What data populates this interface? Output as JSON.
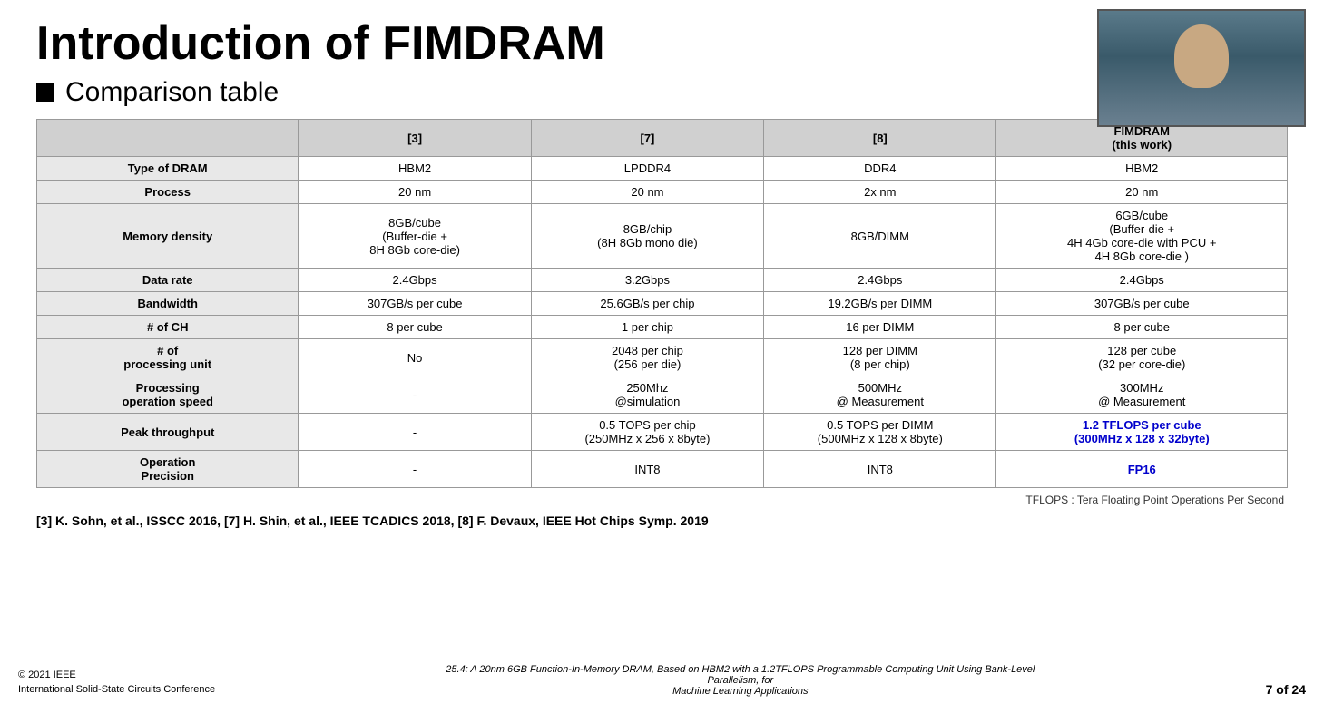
{
  "title": "Introduction of FIMDRAM",
  "subtitle": "Comparison table",
  "webcam_alt": "presenter webcam",
  "table": {
    "headers": [
      "",
      "[3]",
      "[7]",
      "[8]",
      "FIMDRAM\n(this work)"
    ],
    "rows": [
      {
        "label": "Type of DRAM",
        "col3": "HBM2",
        "col7": "LPDDR4",
        "col8": "DDR4",
        "fimdram": "HBM2",
        "fimdram_blue": false
      },
      {
        "label": "Process",
        "col3": "20 nm",
        "col7": "20 nm",
        "col8": "2x nm",
        "fimdram": "20 nm",
        "fimdram_blue": false
      },
      {
        "label": "Memory density",
        "col3": "8GB/cube\n(Buffer-die +\n8H 8Gb core-die)",
        "col7": "8GB/chip\n(8H 8Gb mono die)",
        "col8": "8GB/DIMM",
        "fimdram": "6GB/cube\n(Buffer-die +\n4H 4Gb core-die with PCU +\n4H 8Gb core-die )",
        "fimdram_blue": false
      },
      {
        "label": "Data rate",
        "col3": "2.4Gbps",
        "col7": "3.2Gbps",
        "col8": "2.4Gbps",
        "fimdram": "2.4Gbps",
        "fimdram_blue": false
      },
      {
        "label": "Bandwidth",
        "col3": "307GB/s per cube",
        "col7": "25.6GB/s per chip",
        "col8": "19.2GB/s per DIMM",
        "fimdram": "307GB/s per cube",
        "fimdram_blue": false
      },
      {
        "label": "# of CH",
        "col3": "8 per cube",
        "col7": "1 per chip",
        "col8": "16 per DIMM",
        "fimdram": "8 per cube",
        "fimdram_blue": false
      },
      {
        "label": "# of\nprocessing unit",
        "col3": "No",
        "col7": "2048 per chip\n(256 per die)",
        "col8": "128 per DIMM\n(8 per chip)",
        "fimdram": "128 per cube\n(32 per core-die)",
        "fimdram_blue": false
      },
      {
        "label": "Processing\noperation speed",
        "col3": "-",
        "col7": "250Mhz\n@simulation",
        "col8": "500MHz\n@ Measurement",
        "fimdram": "300MHz\n@ Measurement",
        "fimdram_blue": false
      },
      {
        "label": "Peak throughput",
        "col3": "-",
        "col7": "0.5 TOPS per chip\n(250MHz x 256 x 8byte)",
        "col8": "0.5 TOPS per DIMM\n(500MHz x 128 x 8byte)",
        "fimdram": "1.2 TFLOPS per cube\n(300MHz x 128 x 32byte)",
        "fimdram_blue": true
      },
      {
        "label": "Operation\nPrecision",
        "col3": "-",
        "col7": "INT8",
        "col8": "INT8",
        "fimdram": "FP16",
        "fimdram_blue": true
      }
    ]
  },
  "tflops_note": "TFLOPS : Tera Floating Point Operations Per Second",
  "references": "[3] K. Sohn, et al., ISSCC 2016, [7] H. Shin, et al., IEEE TCADICS 2018, [8] F. Devaux, IEEE Hot Chips Symp. 2019",
  "footer": {
    "left_line1": "© 2021 IEEE",
    "left_line2": "International Solid-State Circuits Conference",
    "center": "25.4: A 20nm 6GB Function-In-Memory DRAM, Based on HBM2 with a 1.2TFLOPS Programmable Computing Unit Using Bank-Level Parallelism, for\nMachine Learning Applications",
    "right": "7 of 24"
  }
}
